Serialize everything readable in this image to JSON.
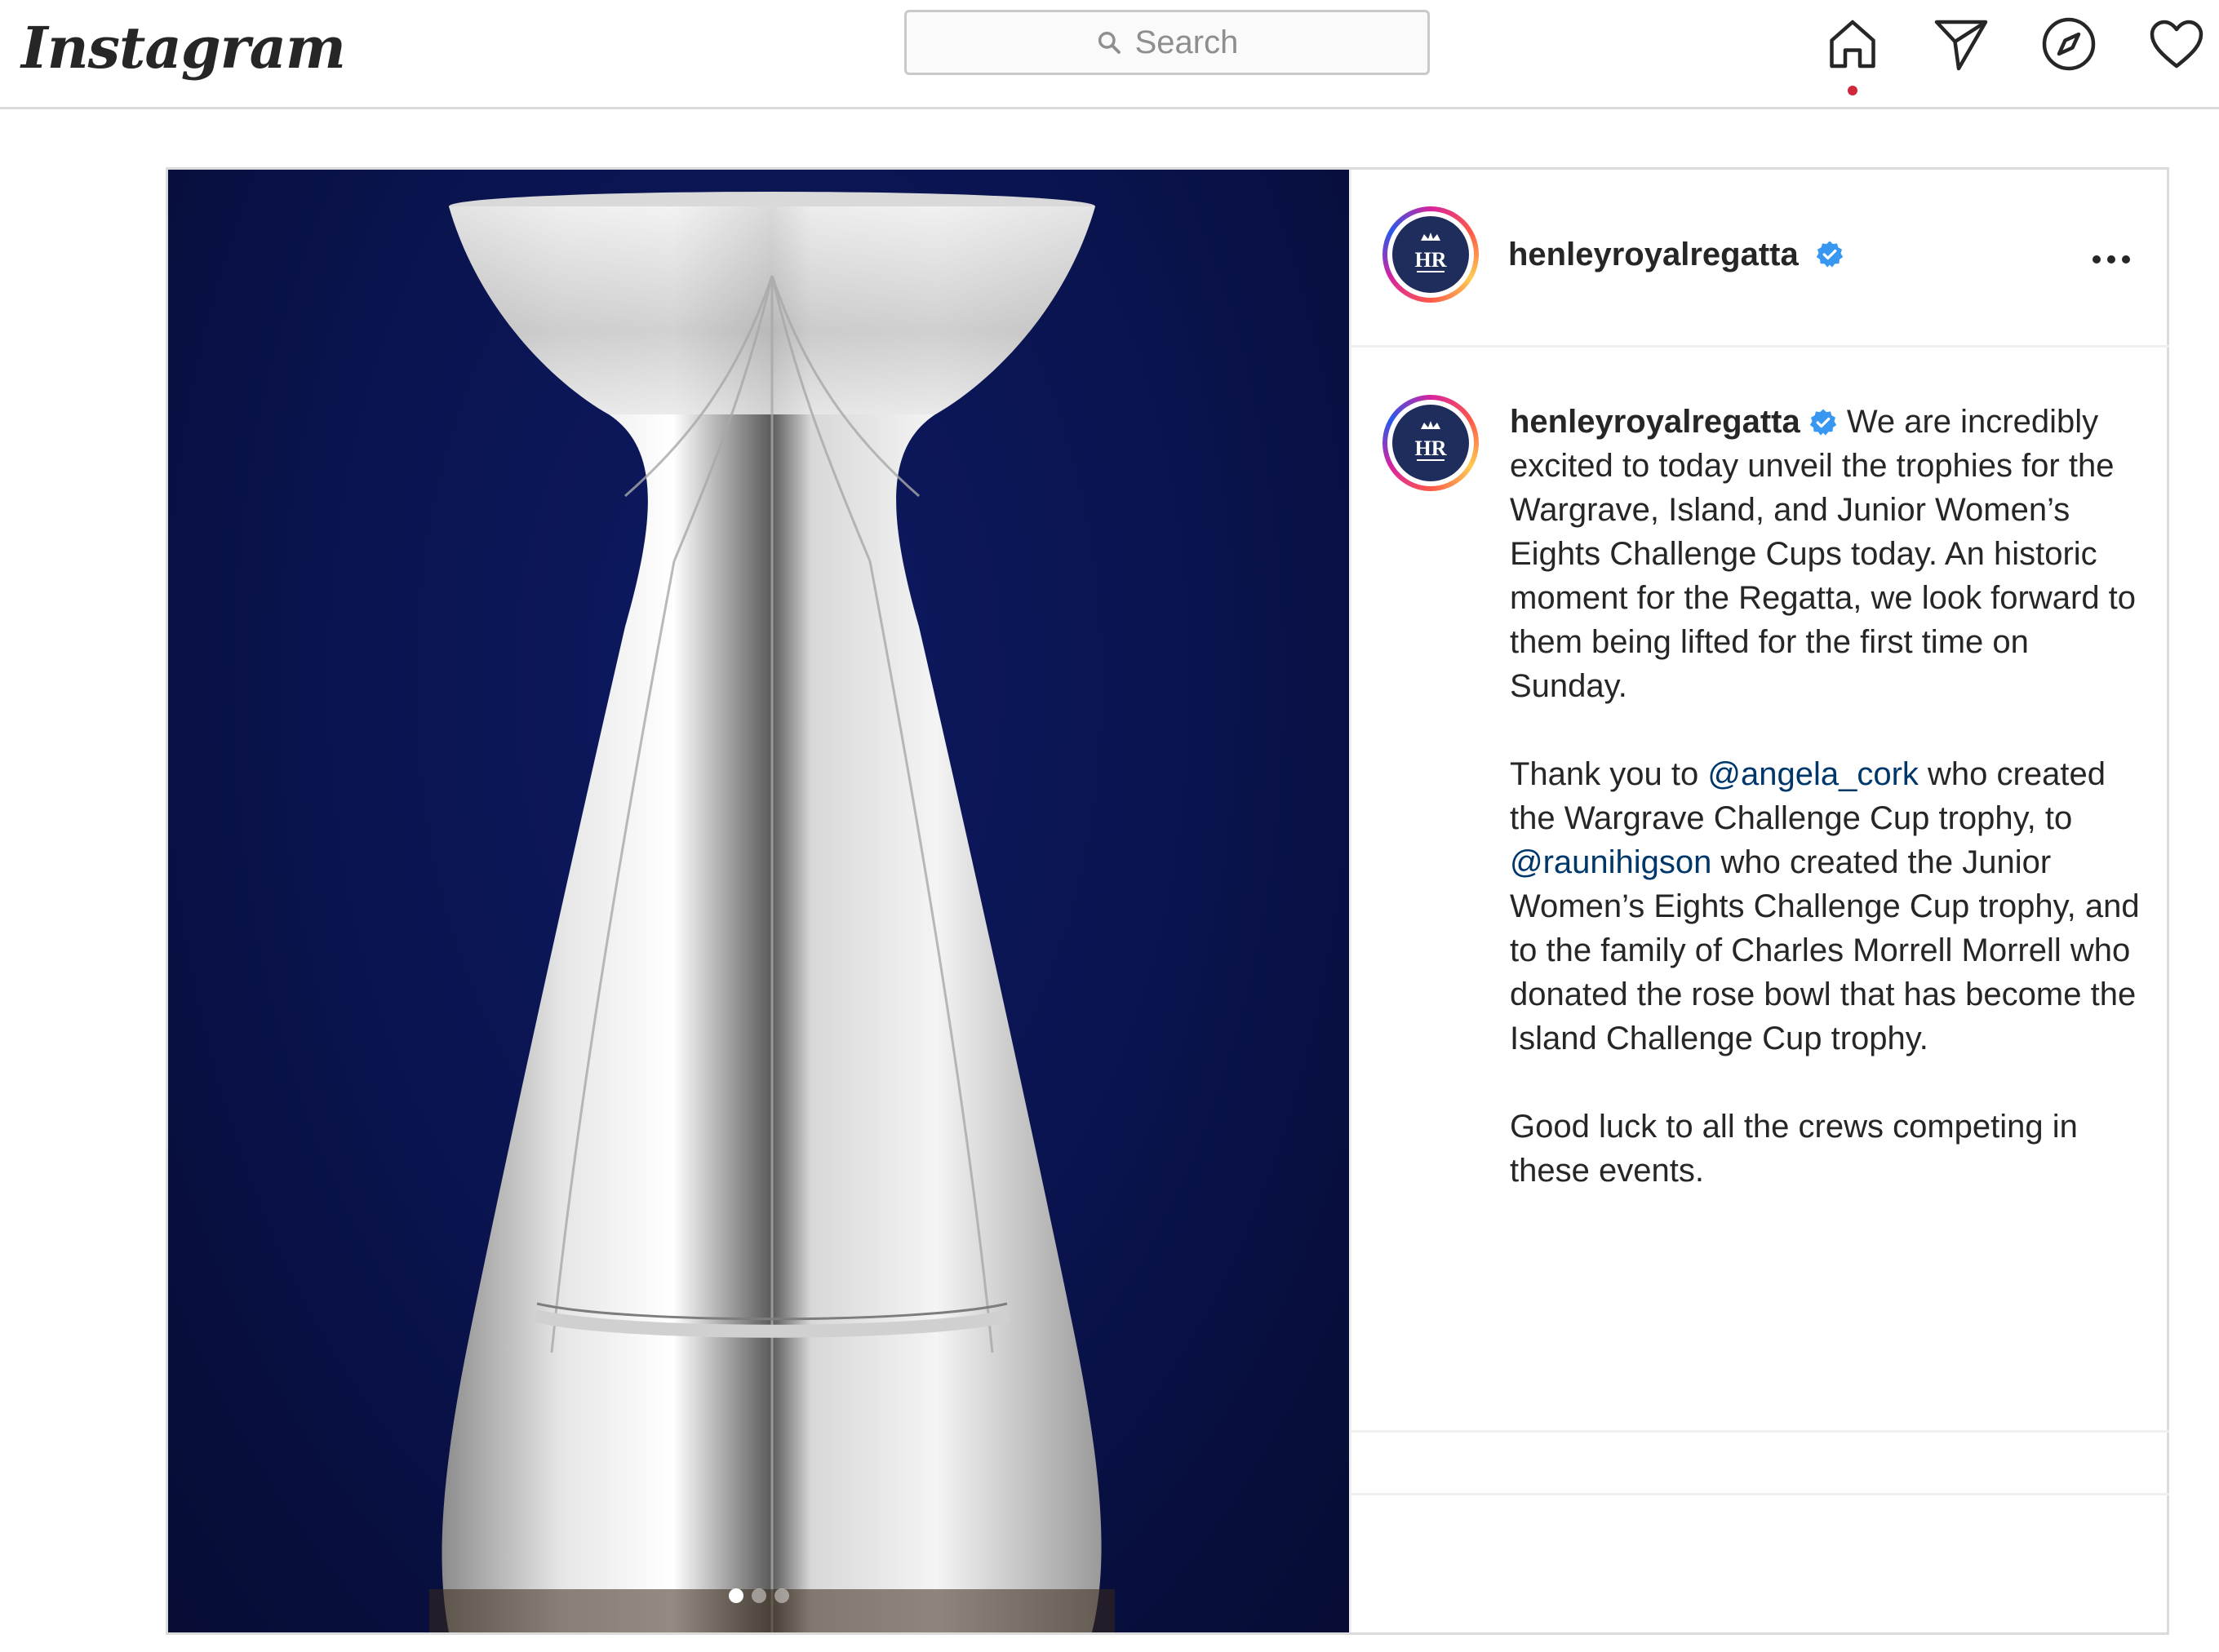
{
  "nav": {
    "logo": "Instagram",
    "search_placeholder": "Search",
    "icons": [
      "home-icon",
      "direct-message-icon",
      "explore-icon",
      "activity-heart-icon"
    ],
    "notification_dot_color": "#d0283a"
  },
  "post": {
    "username": "henleyroyalregatta",
    "verified": true,
    "more_icon": "more-options-icon",
    "caption": {
      "username": "henleyroyalregatta",
      "p1": " We are incredibly excited to today unveil the trophies for the Wargrave, Island, and Junior Women’s Eights Challenge Cups today. An historic moment for the Regatta, we look forward to them being lifted for the first time on Sunday.",
      "p2_a": "Thank you to ",
      "mention1": "@angela_cork",
      "p2_b": " who created the Wargrave Challenge Cup trophy, to ",
      "mention2": "@raunihigson",
      "p2_c": " who created the Junior Women’s Eights Challenge Cup trophy, and to the family of Charles Morrell Morrell who donated the rose bowl that has become the Island Challenge Cup trophy.",
      "p3": "Good luck to all the crews competing in these events."
    },
    "carousel": {
      "total": 3,
      "active_index": 0
    },
    "colors": {
      "mention": "#00376b",
      "background_photo": "#0a134d",
      "verified": "#3897f0"
    }
  }
}
